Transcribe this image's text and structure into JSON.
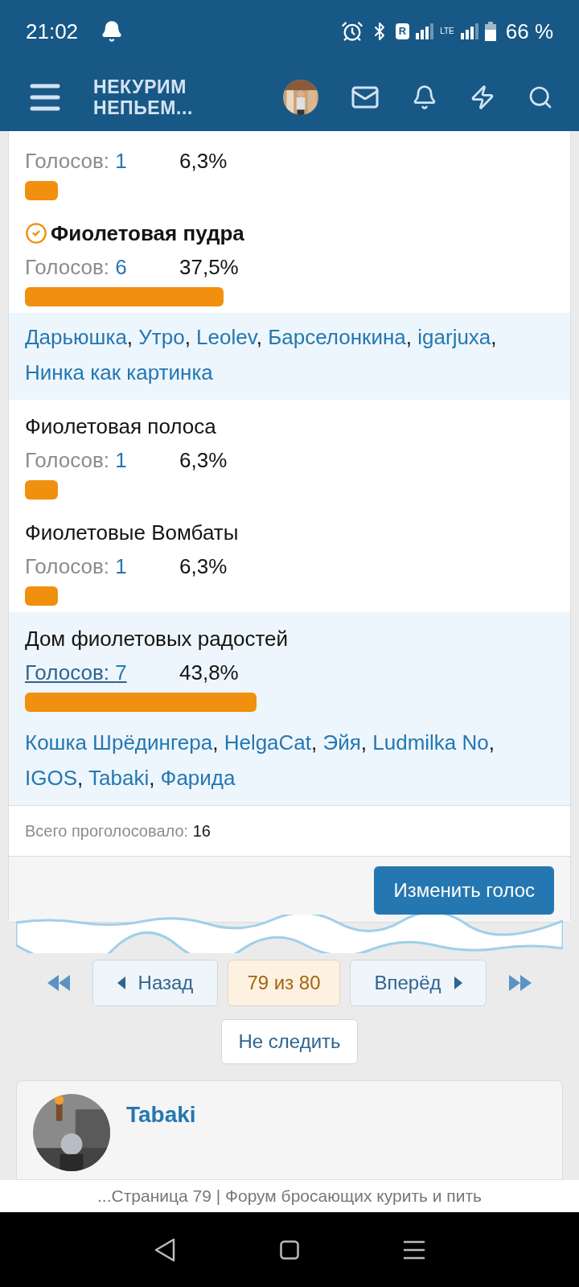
{
  "status_bar": {
    "time": "21:02",
    "roaming": "R",
    "network": "LTE",
    "battery": "66 %"
  },
  "header": {
    "logo_line_1": "НЕКУРИМ",
    "logo_line_2": "НЕПЬЕМ..."
  },
  "poll": {
    "options": [
      {
        "highlighted": false,
        "votes_label": "Голосов:",
        "votes": "1",
        "percent": "6,3%"
      },
      {
        "name": "Фиолетовая пудра",
        "voted": true,
        "highlighted": false,
        "votes_label": "Голосов:",
        "votes": "6",
        "percent": "37,5%",
        "voters": [
          "Дарьюшка",
          "Утро",
          "Leolev",
          "Барселонкина",
          "igarjuxa",
          "Нинка как картинка"
        ]
      },
      {
        "name": "Фиолетовая полоса",
        "voted": false,
        "highlighted": false,
        "votes_label": "Голосов:",
        "votes": "1",
        "percent": "6,3%"
      },
      {
        "name": "Фиолетовые Вомбаты",
        "voted": false,
        "highlighted": false,
        "votes_label": "Голосов:",
        "votes": "1",
        "percent": "6,3%"
      },
      {
        "name": "Дом фиолетовых радостей",
        "voted": false,
        "highlighted": true,
        "votes_label": "Голосов:",
        "votes": "7",
        "percent": "43,8%",
        "voters": [
          "Кошка Шрёдингера",
          "HelgaCat",
          "Эйя",
          "Ludmilka No",
          "IGOS",
          "Tabaki",
          "Фарида"
        ]
      }
    ],
    "separator": ", ",
    "total_label": "Всего проголосовало:",
    "total": "16",
    "change_button": "Изменить голос"
  },
  "pagination": {
    "prev": "Назад",
    "current": "79 из 80",
    "next": "Вперёд"
  },
  "unwatch_button": "Не следить",
  "post": {
    "author": "Tabaki"
  },
  "browser_title": "...Страница 79 | Форум бросающих курить и пить"
}
